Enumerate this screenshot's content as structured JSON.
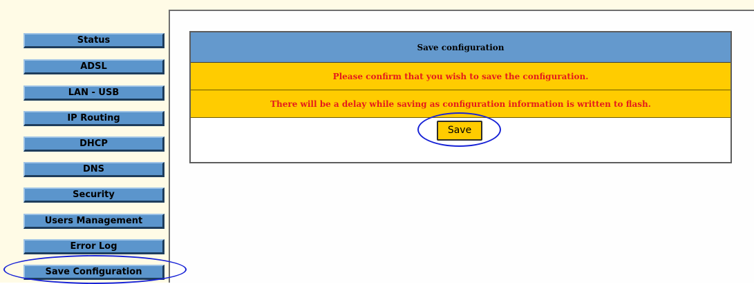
{
  "sidebar": {
    "items": [
      {
        "label": "Status"
      },
      {
        "label": "ADSL"
      },
      {
        "label": "LAN - USB"
      },
      {
        "label": "IP Routing"
      },
      {
        "label": "DHCP"
      },
      {
        "label": "DNS"
      },
      {
        "label": "Security"
      },
      {
        "label": "Users Management"
      },
      {
        "label": "Error Log"
      },
      {
        "label": "Save Configuration"
      }
    ]
  },
  "main": {
    "title": "Save configuration",
    "message_confirm": "Please confirm that you wish to save the configuration.",
    "message_delay": "There will be a delay while saving as configuration information is written to flash.",
    "save_label": "Save"
  },
  "colors": {
    "nav_button": "#5b95cc",
    "header_blue": "#6499cd",
    "message_yellow": "#ffcc00",
    "message_text": "#e41b1b",
    "annotation": "#1722d6"
  }
}
